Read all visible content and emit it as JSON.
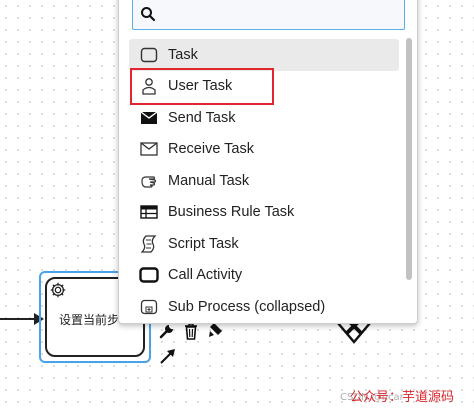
{
  "canvas": {
    "task_label": "设置当前步"
  },
  "popup": {
    "search": {
      "value": "",
      "placeholder": ""
    },
    "items": [
      {
        "label": "Task",
        "icon": "task-icon",
        "active": true
      },
      {
        "label": "User Task",
        "icon": "user-task-icon",
        "active": false
      },
      {
        "label": "Send Task",
        "icon": "send-task-icon",
        "active": false
      },
      {
        "label": "Receive Task",
        "icon": "receive-task-icon",
        "active": false
      },
      {
        "label": "Manual Task",
        "icon": "manual-task-icon",
        "active": false
      },
      {
        "label": "Business Rule Task",
        "icon": "business-rule-task-icon",
        "active": false
      },
      {
        "label": "Script Task",
        "icon": "script-task-icon",
        "active": false
      },
      {
        "label": "Call Activity",
        "icon": "call-activity-icon",
        "active": false
      },
      {
        "label": "Sub Process (collapsed)",
        "icon": "sub-process-collapsed-icon",
        "active": false
      }
    ]
  },
  "watermark": {
    "text": "公众号：芋道源码",
    "source": "CSDN @ncar"
  },
  "colors": {
    "selection": "#4aa3e8",
    "highlight": "#e0262f",
    "search_border": "#5aaeea"
  }
}
